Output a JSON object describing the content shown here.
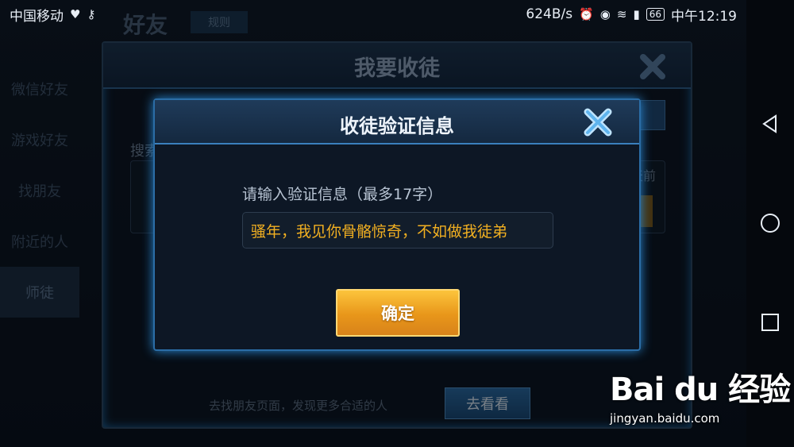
{
  "status_bar": {
    "carrier": "中国移动",
    "net_speed": "624B/s",
    "battery": "66",
    "time": "中午12:19"
  },
  "background": {
    "title": "好友",
    "rules_label": "规则",
    "side_items": [
      "微信好友",
      "游戏好友",
      "找朋友",
      "附近的人",
      "师徒"
    ],
    "hint_text": "去找朋友页面，发现更多合适的人",
    "go_button": "去看看"
  },
  "outer_dialog": {
    "title": "我要收徒",
    "search_label": "搜索",
    "tag_text": "天前"
  },
  "dialog": {
    "title": "收徒验证信息",
    "prompt": "请输入验证信息（最多17字）",
    "input_value": "骚年，我见你骨骼惊奇，不如做我徒弟",
    "confirm_label": "确定"
  },
  "watermark": {
    "logo": "Bai du 经验",
    "url": "jingyan.baidu.com"
  },
  "colors": {
    "accent_blue": "#2b6da6",
    "confirm_gold": "#f2a526",
    "input_text": "#f2b021"
  }
}
